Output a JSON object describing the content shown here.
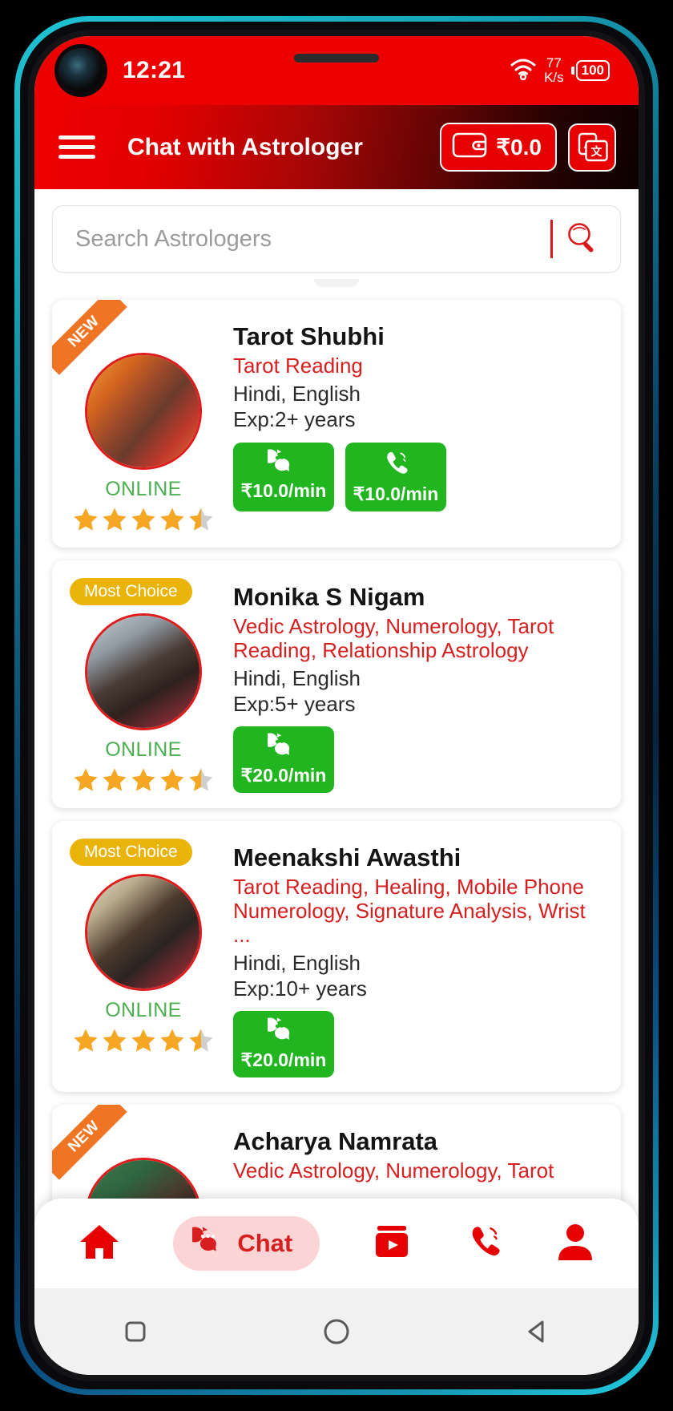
{
  "status_bar": {
    "time": "12:21",
    "network_speed_value": "77",
    "network_speed_unit": "K/s",
    "battery_level": "100",
    "wifi_icon": "wifi-icon"
  },
  "app_bar": {
    "menu_icon": "hamburger-menu-icon",
    "title": "Chat with Astrologer",
    "wallet_icon": "wallet-icon",
    "wallet_amount": "₹0.0",
    "translate_icon": "translate-icon"
  },
  "search": {
    "placeholder": "Search Astrologers",
    "value": "",
    "icon": "search-icon"
  },
  "astrologers": [
    {
      "badge": "NEW",
      "badge_type": "new",
      "name": "Tarot Shubhi",
      "skills": "Tarot Reading",
      "languages": "Hindi, English",
      "experience": "Exp:2+ years",
      "status": "ONLINE",
      "rating": 4.5,
      "actions": [
        {
          "type": "chat",
          "icon": "chat-bubble-icon",
          "price": "₹10.0/min"
        },
        {
          "type": "call",
          "icon": "phone-call-icon",
          "price": "₹10.0/min"
        }
      ]
    },
    {
      "badge": "Most Choice",
      "badge_type": "most-choice",
      "name": "Monika S Nigam",
      "skills": "Vedic Astrology, Numerology, Tarot Reading, Relationship Astrology",
      "languages": "Hindi, English",
      "experience": "Exp:5+ years",
      "status": "ONLINE",
      "rating": 4.5,
      "actions": [
        {
          "type": "chat",
          "icon": "chat-bubble-icon",
          "price": "₹20.0/min"
        }
      ]
    },
    {
      "badge": "Most Choice",
      "badge_type": "most-choice",
      "name": "Meenakshi Awasthi",
      "skills": "Tarot Reading, Healing, Mobile Phone Numerology, Signature Analysis, Wrist ...",
      "languages": "Hindi, English",
      "experience": "Exp:10+ years",
      "status": "ONLINE",
      "rating": 4.5,
      "actions": [
        {
          "type": "chat",
          "icon": "chat-bubble-icon",
          "price": "₹20.0/min"
        }
      ]
    },
    {
      "badge": "NEW",
      "badge_type": "new",
      "name": "Acharya Namrata",
      "skills": "Vedic Astrology, Numerology, Tarot",
      "languages": "",
      "experience": "",
      "status": "",
      "rating": 0,
      "actions": []
    }
  ],
  "bottom_nav": [
    {
      "id": "home",
      "icon": "home-icon",
      "label": "",
      "active": false
    },
    {
      "id": "chat",
      "icon": "chat-bubble-icon",
      "label": "Chat",
      "active": true
    },
    {
      "id": "video",
      "icon": "video-play-icon",
      "label": "",
      "active": false
    },
    {
      "id": "call",
      "icon": "phone-call-icon",
      "label": "",
      "active": false
    },
    {
      "id": "profile",
      "icon": "person-icon",
      "label": "",
      "active": false
    }
  ],
  "android_nav": [
    {
      "id": "recents",
      "icon": "square-recents-icon"
    },
    {
      "id": "home",
      "icon": "circle-home-icon"
    },
    {
      "id": "back",
      "icon": "triangle-back-icon"
    }
  ],
  "colors": {
    "brand_red": "#e60000",
    "accent_green": "#21b520",
    "badge_gold": "#eab308",
    "badge_orange": "#ef7524",
    "online_green": "#4caf50",
    "star_orange": "#f5a623"
  }
}
